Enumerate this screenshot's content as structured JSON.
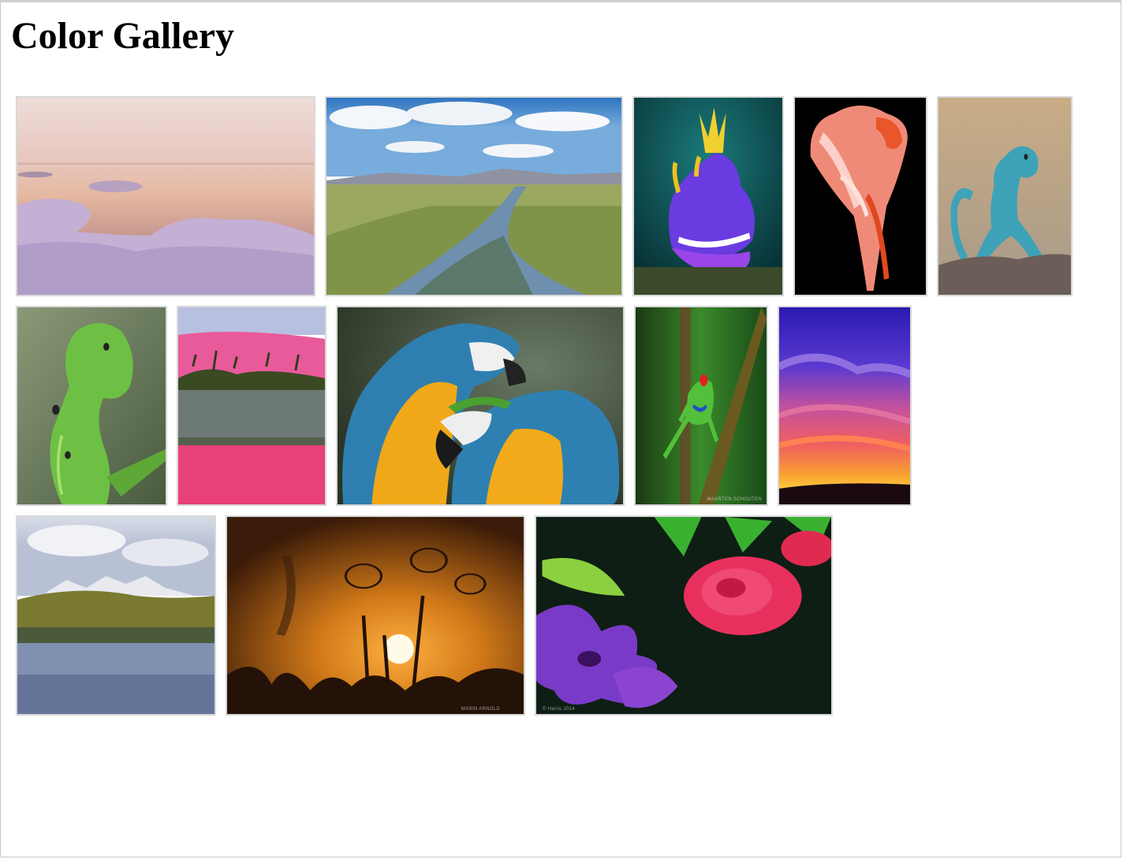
{
  "page": {
    "title": "Color Gallery"
  },
  "gallery": {
    "photos": [
      {
        "subject": "icy lake at pastel sunset"
      },
      {
        "subject": "stream through green valley with blue sky"
      },
      {
        "subject": "purple nudibranch with yellow horns"
      },
      {
        "subject": "pink flamingo on black background"
      },
      {
        "subject": "blue collared lizard on rock"
      },
      {
        "subject": "green hornworm caterpillar"
      },
      {
        "subject": "pink dunes above oasis lake"
      },
      {
        "subject": "two blue-and-yellow macaws"
      },
      {
        "subject": "red-eyed tree frog on stem"
      },
      {
        "subject": "purple and orange sunset sky"
      },
      {
        "subject": "mountain lake with snowy peaks"
      },
      {
        "subject": "sunset behind plant silhouettes"
      },
      {
        "subject": "pink rose and purple clematis flowers"
      }
    ]
  },
  "colors": {
    "border": "#d8d8d8",
    "title": "#000000"
  }
}
